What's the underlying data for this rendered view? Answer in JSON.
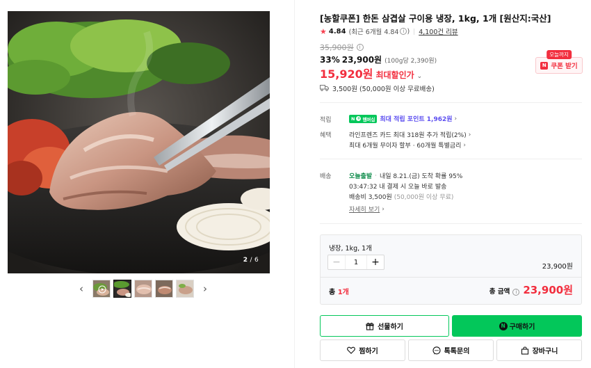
{
  "gallery": {
    "current": "2",
    "total": "/ 6",
    "prev_icon": "chevron-left-icon",
    "next_icon": "chevron-right-icon",
    "thumb_count": 5
  },
  "product": {
    "title": "[농할쿠폰] 한돈 삼겹살 구이용 냉장, 1kg, 1개 [원산지:국산]",
    "rating": "4.84",
    "rating_detail": "(최근 6개월 4.84",
    "rating_detail_close": ")",
    "reviews": "4,100건 리뷰",
    "original_price": "35,900원",
    "discount_rate": "33%",
    "sale_price": "23,900원",
    "unit_price": "(100g당 2,390원)",
    "max_discount_price": "15,920원",
    "max_discount_label": "최대할인가",
    "shipping": "3,500원 (50,000원 이상 무료배송)"
  },
  "coupon": {
    "badge": "오늘까지",
    "label": "쿠폰 받기"
  },
  "benefits": {
    "points_label": "적립",
    "npay_text": "멤버십",
    "points_text": "최대 적립 포인트 1,962원",
    "perks_label": "혜택",
    "perk1": "라인프렌즈 카드 최대 318원 추가 적립(2%)",
    "perk2": "최대 6개월 무이자 할부 · 60개월 특별금리"
  },
  "delivery": {
    "label": "배송",
    "today_tag": "오늘출발",
    "arrival": "내일 8.21.(금) 도착 확률 95%",
    "deadline": "03:47:32 내 결제 시 오늘 바로 발송",
    "fee": "배송비 3,500원",
    "fee_note": "(50,000원 이상 무료)",
    "detail_link": "자세히 보기"
  },
  "option": {
    "name": "냉장, 1kg, 1개",
    "quantity": "1",
    "price": "23,900원",
    "total_label_prefix": "총 ",
    "total_count": "1개",
    "total_amount_label": "총 금액",
    "total_amount": "23,900원"
  },
  "buttons": {
    "gift": "선물하기",
    "buy": "구매하기",
    "wish": "찜하기",
    "talk": "톡톡문의",
    "cart": "장바구니"
  },
  "colors": {
    "accent_red": "#f22e3e",
    "naver_green": "#03c75a",
    "purple": "#5b4df0"
  }
}
